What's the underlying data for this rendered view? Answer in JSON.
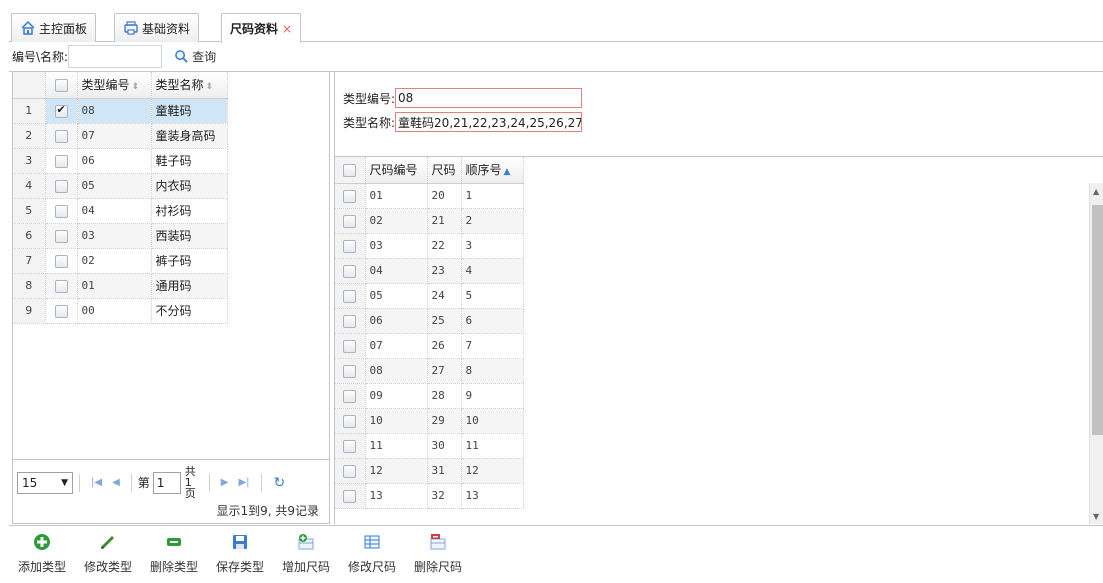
{
  "tabs": [
    {
      "label": "主控面板",
      "icon": "home-icon"
    },
    {
      "label": "基础资料",
      "icon": "printer-icon"
    },
    {
      "label": "尺码资料",
      "close": "×"
    }
  ],
  "search": {
    "label": "编号\\名称:",
    "value": "",
    "button_label": "查询"
  },
  "left_table": {
    "headers": {
      "code": "类型编号",
      "name": "类型名称"
    },
    "rows": [
      {
        "n": "1",
        "code": "08",
        "name": "童鞋码",
        "checked": true
      },
      {
        "n": "2",
        "code": "07",
        "name": "童装身高码"
      },
      {
        "n": "3",
        "code": "06",
        "name": "鞋子码"
      },
      {
        "n": "4",
        "code": "05",
        "name": "内衣码"
      },
      {
        "n": "5",
        "code": "04",
        "name": "衬衫码"
      },
      {
        "n": "6",
        "code": "03",
        "name": "西装码"
      },
      {
        "n": "7",
        "code": "02",
        "name": "裤子码"
      },
      {
        "n": "8",
        "code": "01",
        "name": "通用码"
      },
      {
        "n": "9",
        "code": "00",
        "name": "不分码"
      }
    ]
  },
  "pager": {
    "page_size": "15",
    "page_label": "第",
    "page_value": "1",
    "total_line1": "共1",
    "total_line2": "页",
    "info": "显示1到9, 共9记录"
  },
  "form": {
    "type_code_label": "类型编号:",
    "type_code_value": "08",
    "type_name_label": "类型名称:",
    "type_name_value": "童鞋码20,21,22,23,24,25,26,27"
  },
  "right_table": {
    "headers": {
      "code": "尺码编号",
      "size": "尺码",
      "order": "顺序号"
    },
    "rows": [
      {
        "code": "01",
        "size": "20",
        "order": "1"
      },
      {
        "code": "02",
        "size": "21",
        "order": "2"
      },
      {
        "code": "03",
        "size": "22",
        "order": "3"
      },
      {
        "code": "04",
        "size": "23",
        "order": "4"
      },
      {
        "code": "05",
        "size": "24",
        "order": "5"
      },
      {
        "code": "06",
        "size": "25",
        "order": "6"
      },
      {
        "code": "07",
        "size": "26",
        "order": "7"
      },
      {
        "code": "08",
        "size": "27",
        "order": "8"
      },
      {
        "code": "09",
        "size": "28",
        "order": "9"
      },
      {
        "code": "10",
        "size": "29",
        "order": "10"
      },
      {
        "code": "11",
        "size": "30",
        "order": "11"
      },
      {
        "code": "12",
        "size": "31",
        "order": "12"
      },
      {
        "code": "13",
        "size": "32",
        "order": "13"
      }
    ]
  },
  "toolbar": [
    {
      "label": "添加类型",
      "icon": "add-icon",
      "color": "#2e9b3a"
    },
    {
      "label": "修改类型",
      "icon": "pencil-icon",
      "color": "#3d8f2e"
    },
    {
      "label": "删除类型",
      "icon": "minus-icon",
      "color": "#2e9b3a"
    },
    {
      "label": "保存类型",
      "icon": "save-icon",
      "color": "#3a7bd5"
    },
    {
      "label": "增加尺码",
      "icon": "add-row-icon",
      "color": "#2e9b3a"
    },
    {
      "label": "修改尺码",
      "icon": "edit-table-icon",
      "color": "#3a7bd5"
    },
    {
      "label": "删除尺码",
      "icon": "delete-row-icon",
      "color": "#d04040"
    }
  ]
}
